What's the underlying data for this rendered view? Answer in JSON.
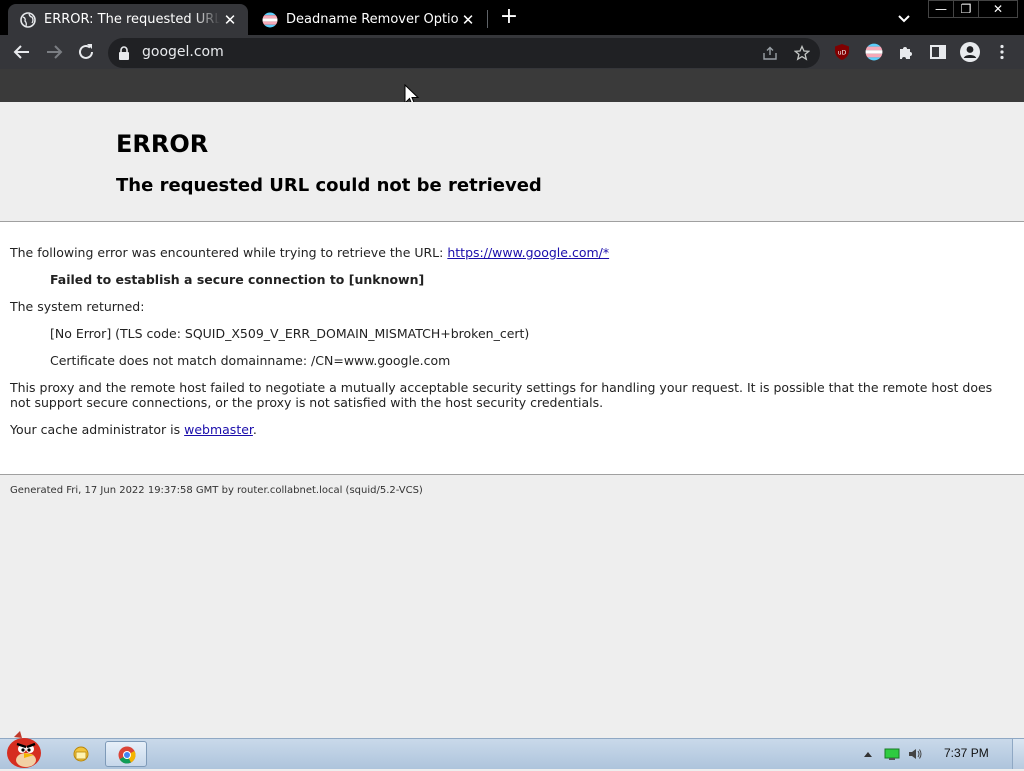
{
  "browser": {
    "tabs": [
      {
        "title": "ERROR: The requested URL could not be retrieved",
        "icon": "globe-icon",
        "active": true
      },
      {
        "title": "Deadname Remover Options",
        "icon": "trans-flag-icon",
        "active": false
      }
    ],
    "tab_close_glyph": "✕",
    "new_tab_glyph": "+",
    "window_controls": {
      "minimize": "—",
      "restore": "❐",
      "close": "✕"
    },
    "address": "googel.com",
    "extensions": [
      "ublock-origin-icon",
      "trans-flag-extension-icon",
      "puzzle-extensions-icon",
      "side-panel-icon",
      "profile-icon",
      "menu-icon"
    ]
  },
  "page": {
    "title": "ERROR",
    "subtitle": "The requested URL could not be retrieved",
    "encountered_text": "The following error was encountered while trying to retrieve the URL: ",
    "encountered_url": "https://www.google.com/*",
    "failure": "Failed to establish a secure connection to [unknown]",
    "system_returned": "The system returned:",
    "tls_error": "[No Error] (TLS code: SQUID_X509_V_ERR_DOMAIN_MISMATCH+broken_cert)",
    "cert_message": "Certificate does not match domainname: /CN=www.google.com",
    "explanation": "This proxy and the remote host failed to negotiate a mutually acceptable security settings for handling your request. It is possible that the remote host does not support secure connections, or the proxy is not satisfied with the host security credentials.",
    "admin_text": "Your cache administrator is ",
    "admin_link": "webmaster",
    "admin_suffix": ".",
    "footer": "Generated Fri, 17 Jun 2022 19:37:58 GMT by router.collabnet.local (squid/5.2-VCS)"
  },
  "taskbar": {
    "clock": "7:37 PM",
    "pinned": [
      "angry-bird-start-icon",
      "explorer-folder-icon",
      "chrome-icon"
    ],
    "tray": [
      "show-hidden-icons-arrow",
      "network-icon",
      "volume-icon"
    ]
  },
  "colors": {
    "tab_strip": "#000000",
    "toolbar": "#35363a",
    "omnibox": "#202124",
    "link": "#1a0dab",
    "page_bg": "#eeeeee"
  }
}
